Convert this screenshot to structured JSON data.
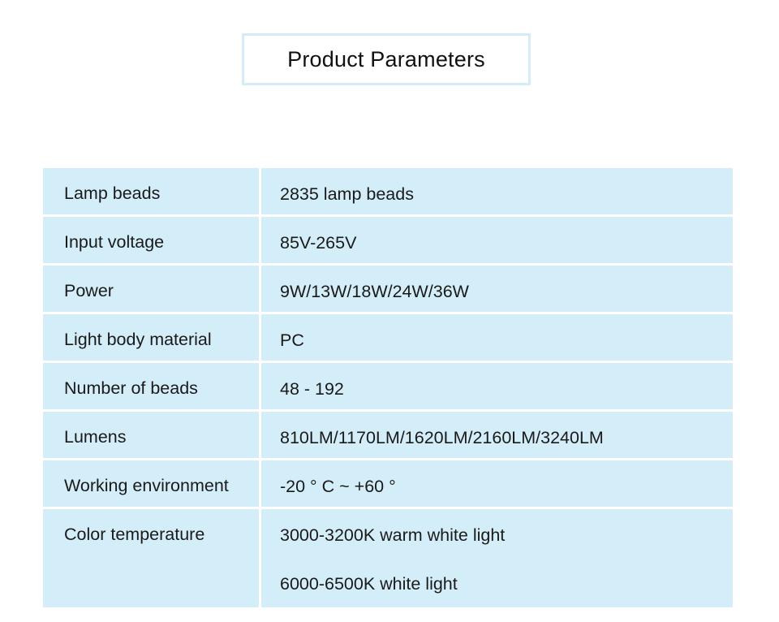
{
  "title": "Product Parameters",
  "rows": [
    {
      "label": "Lamp beads",
      "values": [
        "2835 lamp beads"
      ]
    },
    {
      "label": "Input voltage",
      "values": [
        "85V-265V"
      ]
    },
    {
      "label": "Power",
      "values": [
        "9W/13W/18W/24W/36W"
      ]
    },
    {
      "label": "Light body material",
      "values": [
        "PC"
      ]
    },
    {
      "label": "Number of beads",
      "values": [
        "48 - 192"
      ]
    },
    {
      "label": "Lumens",
      "values": [
        "810LM/1170LM/1620LM/2160LM/3240LM"
      ]
    },
    {
      "label": "Working environment",
      "values": [
        "-20 ° C ~ +60 °"
      ]
    },
    {
      "label": "Color temperature",
      "values": [
        "3000-3200K warm white light",
        "6000-6500K white light"
      ]
    }
  ],
  "colors": {
    "cell_background": "#d4eef9",
    "title_border": "#d3ecf8",
    "text": "#1a1a1a"
  }
}
